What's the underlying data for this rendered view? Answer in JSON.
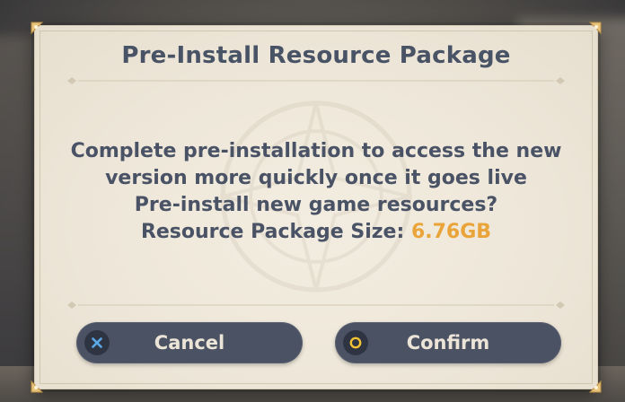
{
  "dialog": {
    "title": "Pre-Install Resource Package",
    "message_lines": [
      "Complete pre-installation to access the new",
      "version more quickly once it goes live",
      "Pre-install new game resources?"
    ],
    "size_label": "Resource Package Size:",
    "size_value": "6.76GB"
  },
  "buttons": {
    "cancel_label": "Cancel",
    "cancel_icon": "cross-icon",
    "confirm_label": "Confirm",
    "confirm_icon": "circle-icon"
  },
  "colors": {
    "panel_bg": "#ede6d8",
    "title_text": "#495366",
    "body_text": "#4a5366",
    "highlight": "#e9a43a",
    "button_bg": "#4b5264",
    "button_text": "#ece5d7",
    "cancel_icon_color": "#5aa8e6",
    "confirm_icon_color": "#f2c230"
  }
}
